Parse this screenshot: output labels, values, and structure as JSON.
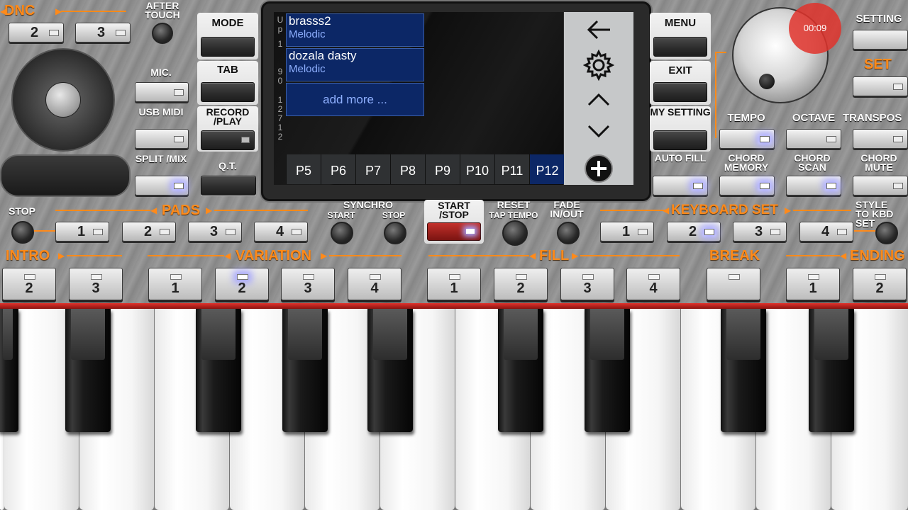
{
  "top_left": {
    "dnc_label": "DNC",
    "aftertouch_label": "AFTER TOUCH",
    "dnc_buttons": [
      {
        "label": "2"
      },
      {
        "label": "3"
      }
    ],
    "mic_label": "MIC.",
    "usb_midi_label": "USB MIDI",
    "split_mix_label": "SPLIT /MIX"
  },
  "center_left": {
    "mode_label": "MODE",
    "tab_label": "TAB",
    "record_label": "RECORD /PLAY",
    "qt_label": "Q.T."
  },
  "screen": {
    "side_text": [
      "U",
      "p",
      "1",
      "9",
      "0",
      "1",
      "2",
      "7",
      "1",
      "2"
    ],
    "items": [
      {
        "title": "brasss2",
        "subtitle": "Melodic"
      },
      {
        "title": "dozala dasty",
        "subtitle": "Melodic"
      }
    ],
    "add_more": "add more ...",
    "tabs": [
      "P5",
      "P6",
      "P7",
      "P8",
      "P9",
      "P10",
      "P11",
      "P12"
    ],
    "active_tab": "P12"
  },
  "center_right": {
    "menu_label": "MENU",
    "exit_label": "EXIT",
    "my_setting_label": "MY SETTING",
    "auto_fill_label": "AUTO FILL"
  },
  "top_right": {
    "timer": "00:09",
    "setting_label": "SETTING",
    "set_label": "SET",
    "tempo_label": "TEMPO",
    "octave_label": "OCTAVE",
    "transpose_label": "TRANSPOS",
    "chord_memory_label": "CHORD MEMORY",
    "chord_scan_label": "CHORD SCAN",
    "chord_mute_label": "CHORD MUTE"
  },
  "row_pads": {
    "stop_label": "STOP",
    "pads_label": "PADS",
    "pads": [
      {
        "label": "1"
      },
      {
        "label": "2"
      },
      {
        "label": "3"
      },
      {
        "label": "4"
      }
    ],
    "synchro_label": "SYNCHRO",
    "synchro_start_label": "START",
    "synchro_stop_label": "STOP",
    "start_stop_label": "START /STOP",
    "reset_label": "RESET",
    "tap_tempo_label": "TAP TEMPO",
    "fade_label": "FADE IN/OUT",
    "keyboard_set_label": "KEYBOARD SET",
    "kbd": [
      {
        "label": "1"
      },
      {
        "label": "2"
      },
      {
        "label": "3"
      },
      {
        "label": "4"
      }
    ],
    "style_kbd_label": "STYLE TO KBD SET"
  },
  "row_style": {
    "intro_label": "INTRO",
    "intro": [
      {
        "label": "2"
      },
      {
        "label": "3"
      }
    ],
    "variation_label": "VARIATION",
    "variation": [
      {
        "label": "1"
      },
      {
        "label": "2"
      },
      {
        "label": "3"
      },
      {
        "label": "4"
      }
    ],
    "fill_label": "FILL",
    "fill": [
      {
        "label": "1"
      },
      {
        "label": "2"
      },
      {
        "label": "3"
      },
      {
        "label": "4"
      }
    ],
    "break_label": "BREAK",
    "ending_label": "ENDING",
    "ending": [
      {
        "label": "1"
      },
      {
        "label": "2"
      }
    ]
  },
  "colors": {
    "accent": "#ff8a1a",
    "screen_item": "#0c2766",
    "led_on": "#a6a6ff",
    "record_red": "#e0322b"
  }
}
